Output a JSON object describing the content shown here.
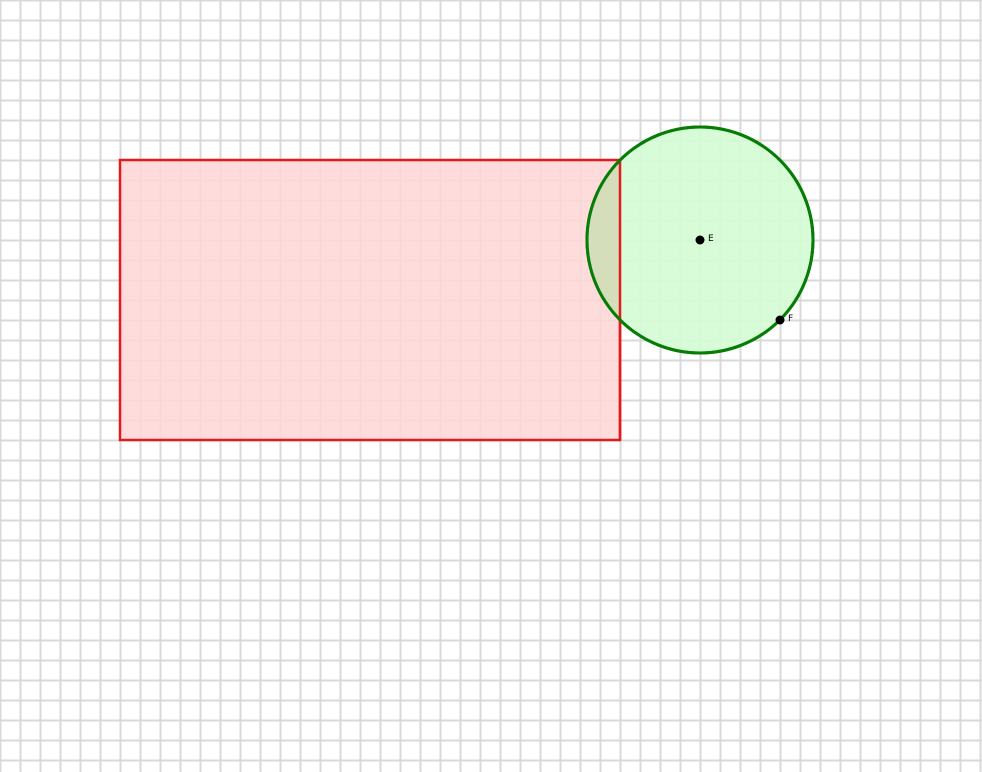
{
  "grid": {
    "line_color": "#d9d9d9",
    "show": true
  },
  "rectangle": {
    "stroke": "#e31a1c",
    "fill": "#ffd6d6"
  },
  "circle": {
    "stroke": "#067d06",
    "fill": "#d4fcd4"
  },
  "points": [
    {
      "label": "E",
      "color": "#000000"
    },
    {
      "label": "F",
      "color": "#000000"
    }
  ]
}
